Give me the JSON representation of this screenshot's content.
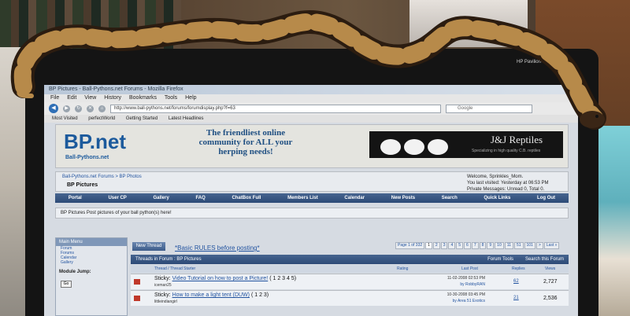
{
  "browser": {
    "title": "BP Pictures - Ball-Pythons.net Forums - Mozilla Firefox",
    "menu": [
      "File",
      "Edit",
      "View",
      "History",
      "Bookmarks",
      "Tools",
      "Help"
    ],
    "url": "http://www.ball-pythons.net/forums/forumdisplay.php?f=63",
    "search_placeholder": "Google",
    "bookmarks": [
      "Most Visited",
      "perfectWorld",
      "Getting Started",
      "Latest Headlines"
    ]
  },
  "laptop_brand": "HP Pavilion dv6000",
  "banner": {
    "logo": "BP.net",
    "logo_sub": "Ball-Pythons.net",
    "tagline": "The friendliest online community for ALL your herping needs!",
    "ad_title": "J&J Reptiles",
    "ad_sub": "Specializing in high quality C.B. reptiles"
  },
  "breadcrumb": {
    "path": "Ball-Pythons.net Forums > BP Photos",
    "title": "BP Pictures"
  },
  "welcome": {
    "line1": "Welcome, Sprinkles_Mom.",
    "line2": "You last visited: Yesterday at 06:53 PM",
    "line3": "Private Messages: Unread 0, Total 0."
  },
  "forum_nav": [
    "Portal",
    "User CP",
    "Gallery",
    "FAQ",
    "ChatBox Full",
    "Members List",
    "Calendar",
    "New Posts",
    "Search",
    "Quick Links",
    "Log Out"
  ],
  "forum_desc": "BP Pictures  Post pictures of your ball python(s) here!",
  "sidebar": {
    "heading": "Main Menu",
    "links": [
      "Forum",
      "Forums",
      "Calendar",
      "Gallery"
    ],
    "jump_label": "Module Jump:",
    "go": "Go"
  },
  "actions": {
    "new_thread": "New Thread",
    "rules_link": "*Basic RULES before posting*"
  },
  "pager": [
    "Page 1 of 332",
    "1",
    "2",
    "3",
    "4",
    "5",
    "6",
    "7",
    "8",
    "9",
    "10",
    "11",
    "51",
    "101",
    ">",
    "Last »"
  ],
  "threads": {
    "heading": "Threads in Forum : BP Pictures",
    "tools": "Forum Tools",
    "search": "Search this Forum",
    "columns": {
      "thread": "Thread / Thread Starter",
      "rating": "Rating",
      "last_post": "Last Post",
      "replies": "Replies",
      "views": "Views"
    },
    "rows": [
      {
        "prefix": "Sticky:",
        "title": "Video Tutorial on how to post a Picture!",
        "pages": "( 1 2 3 4 5)",
        "starter": "iceman25",
        "date": "11-02-2008 02:53 PM",
        "by": "by RobbyRAN",
        "replies": "62",
        "views": "2,727"
      },
      {
        "prefix": "Sticky:",
        "title": "How to make a light tent (DUW)",
        "pages": "( 1 2 3)",
        "starter": "littleindiangirl",
        "date": "10-30-2008 03:45 PM",
        "by": "by Area 51 Exotics",
        "replies": "21",
        "views": "2,536"
      }
    ]
  }
}
